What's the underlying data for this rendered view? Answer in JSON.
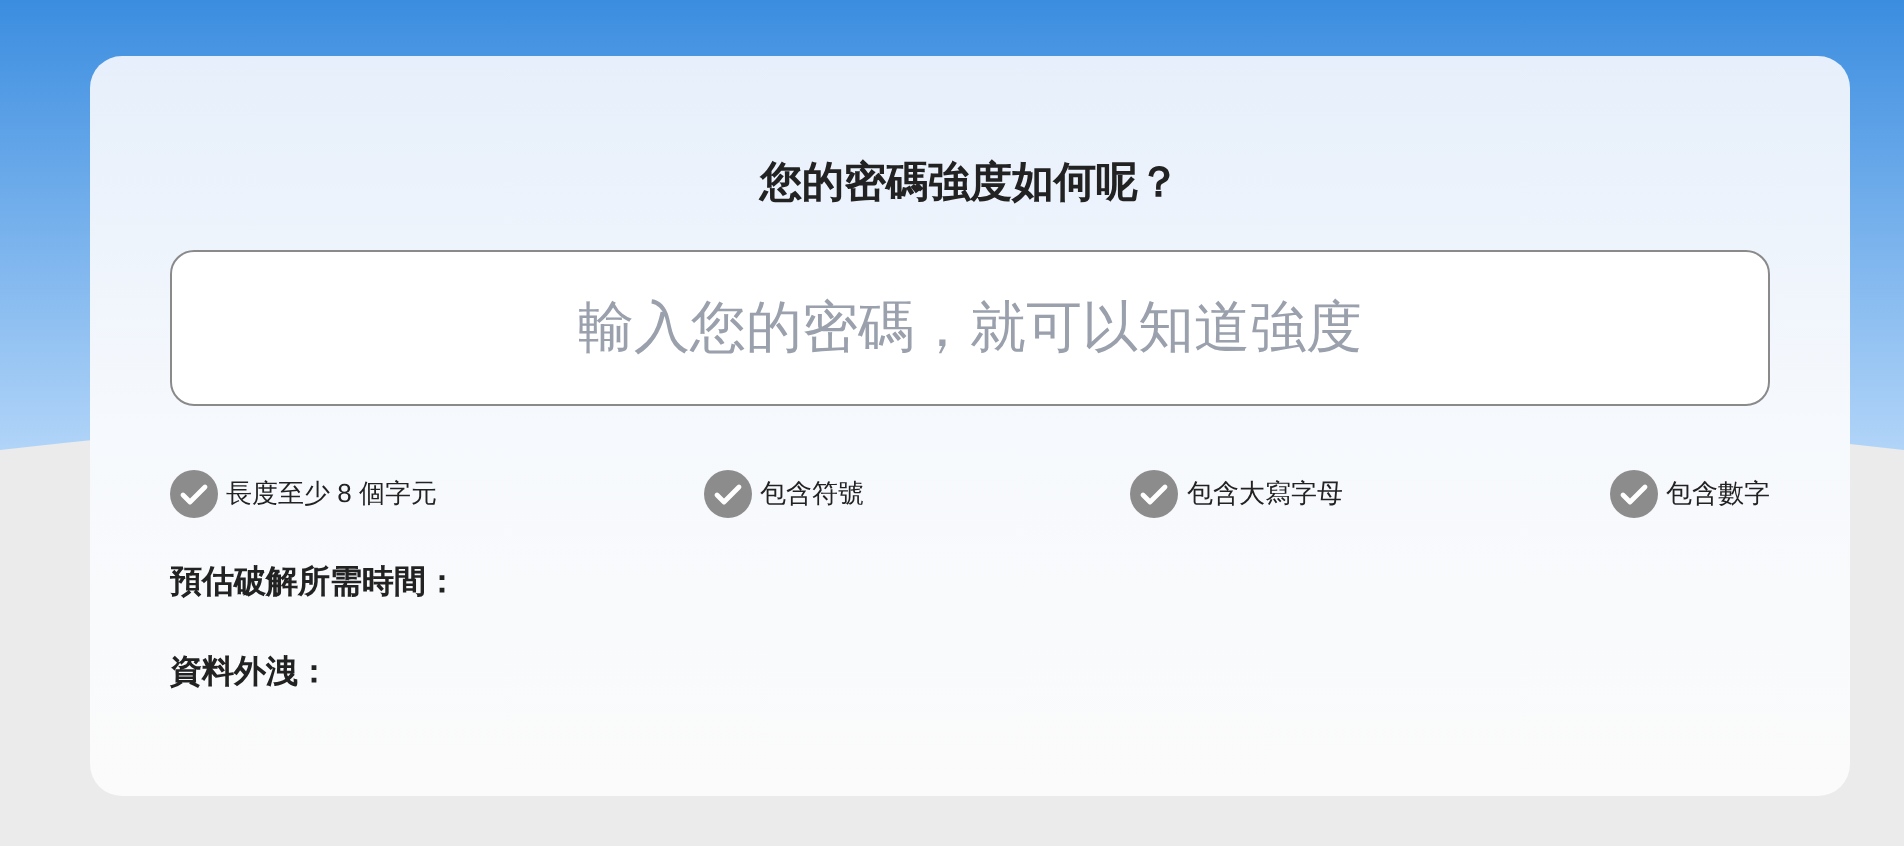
{
  "title": "您的密碼強度如何呢？",
  "password_field": {
    "placeholder": "輸入您的密碼，就可以知道強度"
  },
  "requirements": [
    {
      "label": "長度至少 8 個字元",
      "met": false
    },
    {
      "label": "包含符號",
      "met": false
    },
    {
      "label": "包含大寫字母",
      "met": false
    },
    {
      "label": "包含數字",
      "met": false
    }
  ],
  "results": [
    {
      "label": "預估破解所需時間："
    },
    {
      "label": "資料外洩："
    }
  ]
}
